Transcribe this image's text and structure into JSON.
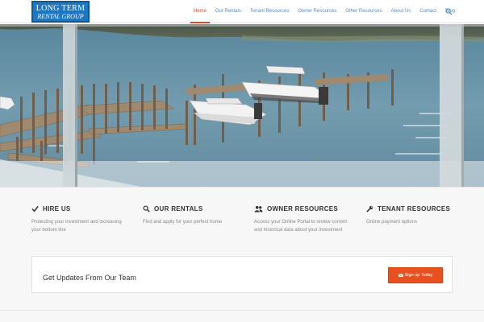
{
  "logo": {
    "line1": "LONG TERM",
    "line2": "RENTAL GROUP"
  },
  "nav": {
    "items": [
      {
        "label": "Home",
        "active": true
      },
      {
        "label": "Our Rentals"
      },
      {
        "label": "Tenant Resources"
      },
      {
        "label": "Owner Resources"
      },
      {
        "label": "Other Resources"
      },
      {
        "label": "About Us"
      },
      {
        "label": "Contact"
      },
      {
        "label": "Blog"
      }
    ],
    "search_icon": "search-icon"
  },
  "hero": {
    "image": "waterfront-docks-with-boats"
  },
  "features": [
    {
      "icon": "check-icon",
      "title": "HIRE US",
      "desc": "Protecting your investment and increasing your bottom line"
    },
    {
      "icon": "search-icon",
      "title": "OUR RENTALS",
      "desc": "Find and apply for your perfect home"
    },
    {
      "icon": "users-icon",
      "title": "OWNER RESOURCES",
      "desc": "Access your Online Portal to review current and historical data about your investment"
    },
    {
      "icon": "wrench-icon",
      "title": "TENANT RESOURCES",
      "desc": "Online payment options"
    }
  ],
  "cta": {
    "title": "Get Updates From Our Team",
    "button_label": "Sign up Today",
    "button_icon": "envelope-icon"
  },
  "colors": {
    "accent": "#d94c1e",
    "link": "#4f8fcb",
    "logo_bg": "#1d78c1",
    "button": "#e8501f"
  }
}
